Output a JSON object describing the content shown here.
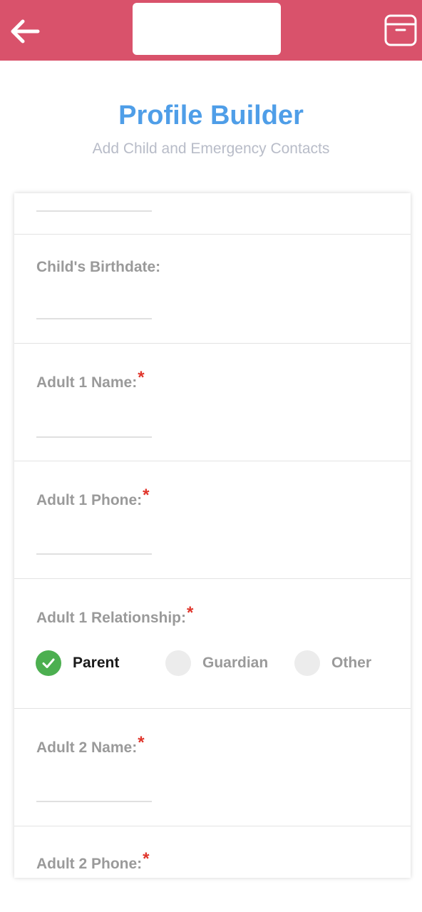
{
  "topbar": {
    "back_icon": "arrow-left-icon",
    "archive_icon": "archive-box-icon",
    "bg_color": "#d9526b"
  },
  "header": {
    "title": "Profile Builder",
    "subtitle": "Add Child and Emergency Contacts",
    "title_color": "#4f9ee8"
  },
  "form": {
    "childs_birthdate": {
      "label": "Child's Birthdate:"
    },
    "adult1_name": {
      "label": "Adult 1 Name:",
      "required_mark": "*"
    },
    "adult1_phone": {
      "label": "Adult 1 Phone:",
      "required_mark": "*"
    },
    "adult1_relationship": {
      "label": "Adult 1 Relationship:",
      "required_mark": "*",
      "options": [
        "Parent",
        "Guardian",
        "Other"
      ],
      "selected": "Parent"
    },
    "adult2_name": {
      "label": "Adult 2 Name:",
      "required_mark": "*"
    },
    "adult2_phone": {
      "label": "Adult 2 Phone:",
      "required_mark": "*"
    }
  }
}
